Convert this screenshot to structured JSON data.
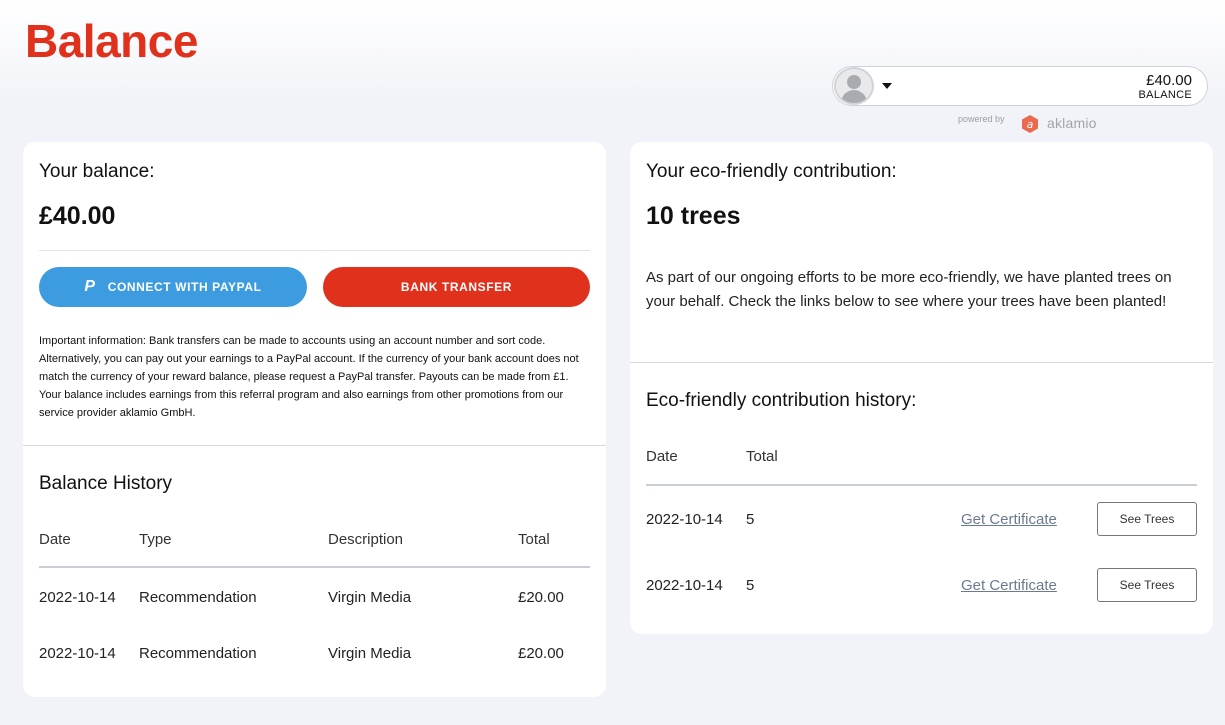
{
  "page": {
    "title": "Balance"
  },
  "account": {
    "amount": "£40.00",
    "label": "BALANCE",
    "powered_by": "powered by",
    "brand": "aklamio"
  },
  "balance_card": {
    "heading": "Your balance:",
    "amount": "£40.00",
    "paypal_button": "CONNECT WITH PAYPAL",
    "bank_button": "BANK TRANSFER",
    "info": "Important information: Bank transfers can be made to accounts using an account number and sort code. Alternatively, you can pay out your earnings to a PayPal account. If the currency of your bank account does not match the currency of your reward balance, please request a PayPal transfer. Payouts can be made from £1. Your balance includes earnings from this referral program and also earnings from other promotions from our service provider aklamio GmbH."
  },
  "balance_history": {
    "title": "Balance History",
    "columns": [
      "Date",
      "Type",
      "Description",
      "Total"
    ],
    "rows": [
      {
        "date": "2022-10-14",
        "type": "Recommendation",
        "description": "Virgin Media",
        "total": "£20.00"
      },
      {
        "date": "2022-10-14",
        "type": "Recommendation",
        "description": "Virgin Media",
        "total": "£20.00"
      }
    ]
  },
  "eco_card": {
    "heading": "Your eco-friendly contribution:",
    "amount": "10 trees",
    "paragraph": "As part of our ongoing efforts to be more eco-friendly, we have planted trees on your behalf. Check the links below to see where your trees have been planted!",
    "history_title": "Eco-friendly contribution history:",
    "columns": [
      "Date",
      "Total"
    ],
    "rows": [
      {
        "date": "2022-10-14",
        "total": "5",
        "link": "Get Certificate",
        "button": "See Trees"
      },
      {
        "date": "2022-10-14",
        "total": "5",
        "link": "Get Certificate",
        "button": "See Trees"
      }
    ]
  },
  "colors": {
    "brand_red": "#e0311c",
    "paypal_blue": "#3d9bdf",
    "background": "#f1f3f8"
  },
  "icons": [
    "user-avatar-icon",
    "chevron-down-icon",
    "aklamio-logo-icon",
    "paypal-icon"
  ]
}
